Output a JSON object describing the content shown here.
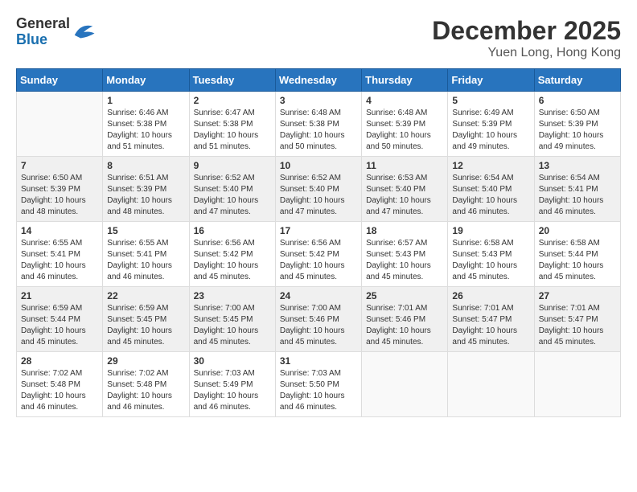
{
  "logo": {
    "general": "General",
    "blue": "Blue"
  },
  "title": "December 2025",
  "subtitle": "Yuen Long, Hong Kong",
  "days_of_week": [
    "Sunday",
    "Monday",
    "Tuesday",
    "Wednesday",
    "Thursday",
    "Friday",
    "Saturday"
  ],
  "weeks": [
    [
      {
        "day": "",
        "info": ""
      },
      {
        "day": "1",
        "info": "Sunrise: 6:46 AM\nSunset: 5:38 PM\nDaylight: 10 hours\nand 51 minutes."
      },
      {
        "day": "2",
        "info": "Sunrise: 6:47 AM\nSunset: 5:38 PM\nDaylight: 10 hours\nand 51 minutes."
      },
      {
        "day": "3",
        "info": "Sunrise: 6:48 AM\nSunset: 5:38 PM\nDaylight: 10 hours\nand 50 minutes."
      },
      {
        "day": "4",
        "info": "Sunrise: 6:48 AM\nSunset: 5:39 PM\nDaylight: 10 hours\nand 50 minutes."
      },
      {
        "day": "5",
        "info": "Sunrise: 6:49 AM\nSunset: 5:39 PM\nDaylight: 10 hours\nand 49 minutes."
      },
      {
        "day": "6",
        "info": "Sunrise: 6:50 AM\nSunset: 5:39 PM\nDaylight: 10 hours\nand 49 minutes."
      }
    ],
    [
      {
        "day": "7",
        "info": "Sunrise: 6:50 AM\nSunset: 5:39 PM\nDaylight: 10 hours\nand 48 minutes."
      },
      {
        "day": "8",
        "info": "Sunrise: 6:51 AM\nSunset: 5:39 PM\nDaylight: 10 hours\nand 48 minutes."
      },
      {
        "day": "9",
        "info": "Sunrise: 6:52 AM\nSunset: 5:40 PM\nDaylight: 10 hours\nand 47 minutes."
      },
      {
        "day": "10",
        "info": "Sunrise: 6:52 AM\nSunset: 5:40 PM\nDaylight: 10 hours\nand 47 minutes."
      },
      {
        "day": "11",
        "info": "Sunrise: 6:53 AM\nSunset: 5:40 PM\nDaylight: 10 hours\nand 47 minutes."
      },
      {
        "day": "12",
        "info": "Sunrise: 6:54 AM\nSunset: 5:40 PM\nDaylight: 10 hours\nand 46 minutes."
      },
      {
        "day": "13",
        "info": "Sunrise: 6:54 AM\nSunset: 5:41 PM\nDaylight: 10 hours\nand 46 minutes."
      }
    ],
    [
      {
        "day": "14",
        "info": "Sunrise: 6:55 AM\nSunset: 5:41 PM\nDaylight: 10 hours\nand 46 minutes."
      },
      {
        "day": "15",
        "info": "Sunrise: 6:55 AM\nSunset: 5:41 PM\nDaylight: 10 hours\nand 46 minutes."
      },
      {
        "day": "16",
        "info": "Sunrise: 6:56 AM\nSunset: 5:42 PM\nDaylight: 10 hours\nand 45 minutes."
      },
      {
        "day": "17",
        "info": "Sunrise: 6:56 AM\nSunset: 5:42 PM\nDaylight: 10 hours\nand 45 minutes."
      },
      {
        "day": "18",
        "info": "Sunrise: 6:57 AM\nSunset: 5:43 PM\nDaylight: 10 hours\nand 45 minutes."
      },
      {
        "day": "19",
        "info": "Sunrise: 6:58 AM\nSunset: 5:43 PM\nDaylight: 10 hours\nand 45 minutes."
      },
      {
        "day": "20",
        "info": "Sunrise: 6:58 AM\nSunset: 5:44 PM\nDaylight: 10 hours\nand 45 minutes."
      }
    ],
    [
      {
        "day": "21",
        "info": "Sunrise: 6:59 AM\nSunset: 5:44 PM\nDaylight: 10 hours\nand 45 minutes."
      },
      {
        "day": "22",
        "info": "Sunrise: 6:59 AM\nSunset: 5:45 PM\nDaylight: 10 hours\nand 45 minutes."
      },
      {
        "day": "23",
        "info": "Sunrise: 7:00 AM\nSunset: 5:45 PM\nDaylight: 10 hours\nand 45 minutes."
      },
      {
        "day": "24",
        "info": "Sunrise: 7:00 AM\nSunset: 5:46 PM\nDaylight: 10 hours\nand 45 minutes."
      },
      {
        "day": "25",
        "info": "Sunrise: 7:01 AM\nSunset: 5:46 PM\nDaylight: 10 hours\nand 45 minutes."
      },
      {
        "day": "26",
        "info": "Sunrise: 7:01 AM\nSunset: 5:47 PM\nDaylight: 10 hours\nand 45 minutes."
      },
      {
        "day": "27",
        "info": "Sunrise: 7:01 AM\nSunset: 5:47 PM\nDaylight: 10 hours\nand 45 minutes."
      }
    ],
    [
      {
        "day": "28",
        "info": "Sunrise: 7:02 AM\nSunset: 5:48 PM\nDaylight: 10 hours\nand 46 minutes."
      },
      {
        "day": "29",
        "info": "Sunrise: 7:02 AM\nSunset: 5:48 PM\nDaylight: 10 hours\nand 46 minutes."
      },
      {
        "day": "30",
        "info": "Sunrise: 7:03 AM\nSunset: 5:49 PM\nDaylight: 10 hours\nand 46 minutes."
      },
      {
        "day": "31",
        "info": "Sunrise: 7:03 AM\nSunset: 5:50 PM\nDaylight: 10 hours\nand 46 minutes."
      },
      {
        "day": "",
        "info": ""
      },
      {
        "day": "",
        "info": ""
      },
      {
        "day": "",
        "info": ""
      }
    ]
  ]
}
